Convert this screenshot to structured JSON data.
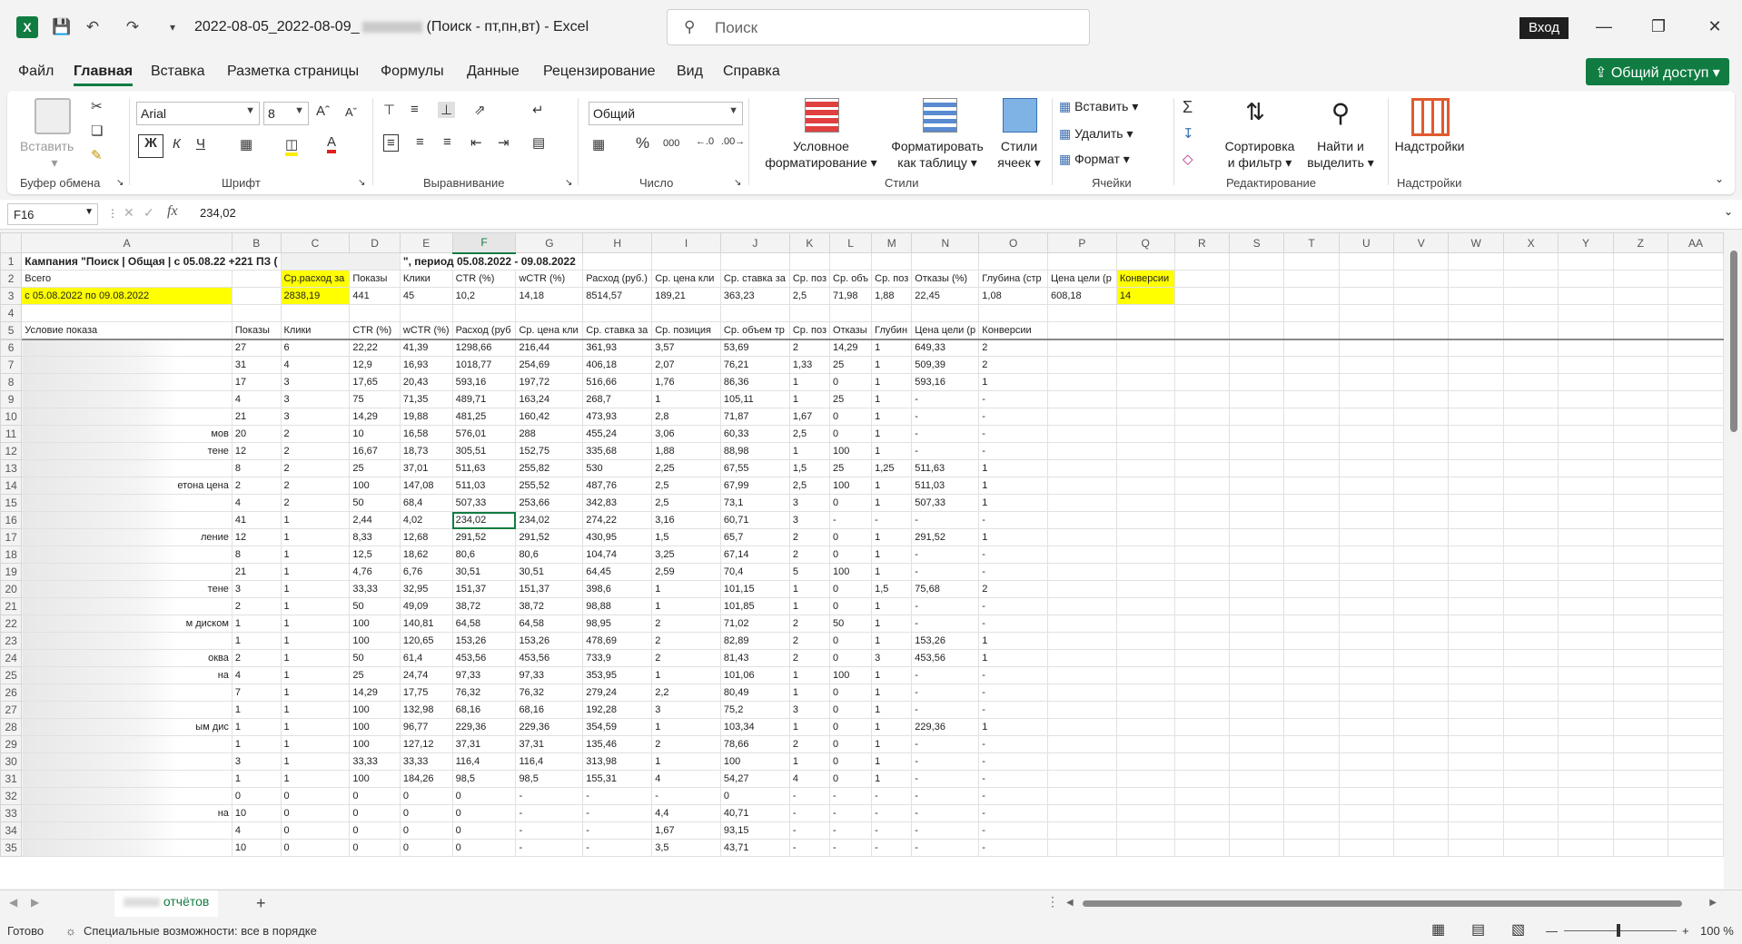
{
  "window": {
    "title": "2022-08-05_2022-08-09_",
    "title_suffix": "(Поиск - пт,пн,вт)  -  Excel",
    "search_placeholder": "Поиск",
    "sign_in": "Вход",
    "app_icon": "excel-icon"
  },
  "menu": {
    "items": [
      "Файл",
      "Главная",
      "Вставка",
      "Разметка страницы",
      "Формулы",
      "Данные",
      "Рецензирование",
      "Вид",
      "Справка"
    ],
    "active": "Главная",
    "share": "Общий доступ"
  },
  "ribbon": {
    "clipboard": {
      "paste": "Вставить",
      "label": "Буфер обмена"
    },
    "font": {
      "name": "Arial",
      "size": "8",
      "bold": "Ж",
      "italic": "К",
      "underline": "Ч",
      "label": "Шрифт"
    },
    "alignment": {
      "label": "Выравнивание"
    },
    "number": {
      "format": "Общий",
      "percent": "%",
      "thousands": "000",
      "label": "Число"
    },
    "styles": {
      "conditional": [
        "Условное",
        "форматирование"
      ],
      "as_table": [
        "Форматировать",
        "как таблицу"
      ],
      "cell_styles": [
        "Стили",
        "ячеек"
      ],
      "label": "Стили"
    },
    "cells": {
      "insert": "Вставить",
      "delete": "Удалить",
      "format": "Формат",
      "label": "Ячейки"
    },
    "editing": {
      "sort": [
        "Сортировка",
        "и фильтр"
      ],
      "find": [
        "Найти и",
        "выделить"
      ],
      "label": "Редактирование"
    },
    "addins": {
      "button": "Надстройки",
      "label": "Надстройки"
    }
  },
  "formula_bar": {
    "name_box": "F16",
    "fx": "fx",
    "value": "234,02"
  },
  "columns": [
    "A",
    "B",
    "C",
    "D",
    "E",
    "F",
    "G",
    "H",
    "I",
    "J",
    "K",
    "L",
    "M",
    "N",
    "O",
    "P",
    "Q",
    "R",
    "S",
    "T",
    "U",
    "V",
    "W",
    "X",
    "Y",
    "Z",
    "AA"
  ],
  "selected_column": "F",
  "sheet": {
    "row1": "Кампания \"Поиск | Общая | с 05.08.22 +221 ПЗ (",
    "row1_tail": "\", период 05.08.2022 - 09.08.2022",
    "row2": [
      "Всего",
      "",
      "Ср.расход за",
      "Показы",
      "Клики",
      "CTR (%)",
      "wCTR (%)",
      "Расход (руб.)",
      "Ср. цена кли",
      "Ср. ставка за",
      "Ср. поз",
      "Ср. объ",
      "Ср. поз",
      "Отказы (%)",
      "Глубина (стр",
      "Цена цели (р",
      "Конверсии"
    ],
    "row3": [
      "с 05.08.2022 по 09.08.2022",
      "",
      "2838,19",
      "441",
      "45",
      "10,2",
      "14,18",
      "8514,57",
      "189,21",
      "363,23",
      "2,5",
      "71,98",
      "1,88",
      "22,45",
      "1,08",
      "608,18",
      "14"
    ],
    "row5": [
      "Условие показа",
      "Показы",
      "Клики",
      "CTR (%)",
      "wCTR (%)",
      "Расход (руб",
      "Ср. цена кли",
      "Ср. ставка за",
      "Ср. позиция",
      "Ср. объем тр",
      "Ср. поз",
      "Отказы",
      "Глубин",
      "Цена цели (р",
      "Конверсии"
    ],
    "data_rows": [
      [
        "",
        "27",
        "6",
        "22,22",
        "41,39",
        "1298,66",
        "216,44",
        "361,93",
        "3,57",
        "53,69",
        "2",
        "14,29",
        "1",
        "649,33",
        "2"
      ],
      [
        "",
        "31",
        "4",
        "12,9",
        "16,93",
        "1018,77",
        "254,69",
        "406,18",
        "2,07",
        "76,21",
        "1,33",
        "25",
        "1",
        "509,39",
        "2"
      ],
      [
        "",
        "17",
        "3",
        "17,65",
        "20,43",
        "593,16",
        "197,72",
        "516,66",
        "1,76",
        "86,36",
        "1",
        "0",
        "1",
        "593,16",
        "1"
      ],
      [
        "",
        "4",
        "3",
        "75",
        "71,35",
        "489,71",
        "163,24",
        "268,7",
        "1",
        "105,11",
        "1",
        "25",
        "1",
        "-",
        "-"
      ],
      [
        "",
        "21",
        "3",
        "14,29",
        "19,88",
        "481,25",
        "160,42",
        "473,93",
        "2,8",
        "71,87",
        "1,67",
        "0",
        "1",
        "-",
        "-"
      ],
      [
        "мов",
        "20",
        "2",
        "10",
        "16,58",
        "576,01",
        "288",
        "455,24",
        "3,06",
        "60,33",
        "2,5",
        "0",
        "1",
        "-",
        "-"
      ],
      [
        "тене",
        "12",
        "2",
        "16,67",
        "18,73",
        "305,51",
        "152,75",
        "335,68",
        "1,88",
        "88,98",
        "1",
        "100",
        "1",
        "-",
        "-"
      ],
      [
        "",
        "8",
        "2",
        "25",
        "37,01",
        "511,63",
        "255,82",
        "530",
        "2,25",
        "67,55",
        "1,5",
        "25",
        "1,25",
        "511,63",
        "1"
      ],
      [
        "етона цена",
        "2",
        "2",
        "100",
        "147,08",
        "511,03",
        "255,52",
        "487,76",
        "2,5",
        "67,99",
        "2,5",
        "100",
        "1",
        "511,03",
        "1"
      ],
      [
        "",
        "4",
        "2",
        "50",
        "68,4",
        "507,33",
        "253,66",
        "342,83",
        "2,5",
        "73,1",
        "3",
        "0",
        "1",
        "507,33",
        "1"
      ],
      [
        "",
        "41",
        "1",
        "2,44",
        "4,02",
        "234,02",
        "234,02",
        "274,22",
        "3,16",
        "60,71",
        "3",
        "-",
        "-",
        "-",
        "-"
      ],
      [
        "ление",
        "12",
        "1",
        "8,33",
        "12,68",
        "291,52",
        "291,52",
        "430,95",
        "1,5",
        "65,7",
        "2",
        "0",
        "1",
        "291,52",
        "1"
      ],
      [
        "",
        "8",
        "1",
        "12,5",
        "18,62",
        "80,6",
        "80,6",
        "104,74",
        "3,25",
        "67,14",
        "2",
        "0",
        "1",
        "-",
        "-"
      ],
      [
        "",
        "21",
        "1",
        "4,76",
        "6,76",
        "30,51",
        "30,51",
        "64,45",
        "2,59",
        "70,4",
        "5",
        "100",
        "1",
        "-",
        "-"
      ],
      [
        "тене",
        "3",
        "1",
        "33,33",
        "32,95",
        "151,37",
        "151,37",
        "398,6",
        "1",
        "101,15",
        "1",
        "0",
        "1,5",
        "75,68",
        "2"
      ],
      [
        "",
        "2",
        "1",
        "50",
        "49,09",
        "38,72",
        "38,72",
        "98,88",
        "1",
        "101,85",
        "1",
        "0",
        "1",
        "-",
        "-"
      ],
      [
        "м диском",
        "1",
        "1",
        "100",
        "140,81",
        "64,58",
        "64,58",
        "98,95",
        "2",
        "71,02",
        "2",
        "50",
        "1",
        "-",
        "-"
      ],
      [
        "",
        "1",
        "1",
        "100",
        "120,65",
        "153,26",
        "153,26",
        "478,69",
        "2",
        "82,89",
        "2",
        "0",
        "1",
        "153,26",
        "1"
      ],
      [
        "оква",
        "2",
        "1",
        "50",
        "61,4",
        "453,56",
        "453,56",
        "733,9",
        "2",
        "81,43",
        "2",
        "0",
        "3",
        "453,56",
        "1"
      ],
      [
        "на",
        "4",
        "1",
        "25",
        "24,74",
        "97,33",
        "97,33",
        "353,95",
        "1",
        "101,06",
        "1",
        "100",
        "1",
        "-",
        "-"
      ],
      [
        "",
        "7",
        "1",
        "14,29",
        "17,75",
        "76,32",
        "76,32",
        "279,24",
        "2,2",
        "80,49",
        "1",
        "0",
        "1",
        "-",
        "-"
      ],
      [
        "",
        "1",
        "1",
        "100",
        "132,98",
        "68,16",
        "68,16",
        "192,28",
        "3",
        "75,2",
        "3",
        "0",
        "1",
        "-",
        "-"
      ],
      [
        "ым дис",
        "1",
        "1",
        "100",
        "96,77",
        "229,36",
        "229,36",
        "354,59",
        "1",
        "103,34",
        "1",
        "0",
        "1",
        "229,36",
        "1"
      ],
      [
        "",
        "1",
        "1",
        "100",
        "127,12",
        "37,31",
        "37,31",
        "135,46",
        "2",
        "78,66",
        "2",
        "0",
        "1",
        "-",
        "-"
      ],
      [
        "",
        "3",
        "1",
        "33,33",
        "33,33",
        "116,4",
        "116,4",
        "313,98",
        "1",
        "100",
        "1",
        "0",
        "1",
        "-",
        "-"
      ],
      [
        "",
        "1",
        "1",
        "100",
        "184,26",
        "98,5",
        "98,5",
        "155,31",
        "4",
        "54,27",
        "4",
        "0",
        "1",
        "-",
        "-"
      ],
      [
        "",
        "0",
        "0",
        "0",
        "0",
        "0",
        "-",
        "-",
        "-",
        "0",
        "-",
        "-",
        "-",
        "-",
        "-"
      ],
      [
        "на",
        "10",
        "0",
        "0",
        "0",
        "0",
        "-",
        "-",
        "4,4",
        "40,71",
        "-",
        "-",
        "-",
        "-",
        "-"
      ],
      [
        "",
        "4",
        "0",
        "0",
        "0",
        "0",
        "-",
        "-",
        "1,67",
        "93,15",
        "-",
        "-",
        "-",
        "-",
        "-"
      ],
      [
        "",
        "10",
        "0",
        "0",
        "0",
        "0",
        "-",
        "-",
        "3,5",
        "43,71",
        "-",
        "-",
        "-",
        "-",
        "-"
      ]
    ]
  },
  "tabs": {
    "sheet": "отчётов",
    "add": "+"
  },
  "status": {
    "ready": "Готово",
    "accessibility": "Специальные возможности: все в порядке",
    "zoom": "100 %"
  }
}
